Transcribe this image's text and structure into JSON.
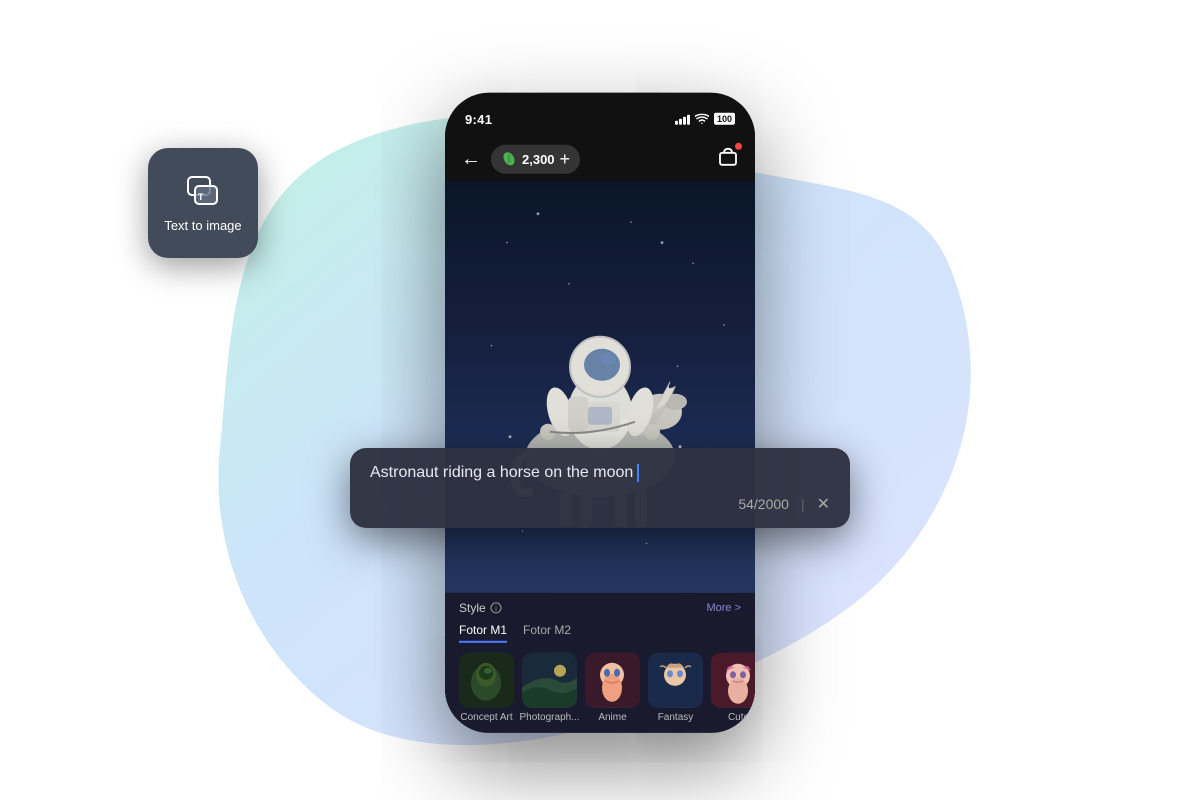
{
  "scene": {
    "background_blob_colors": {
      "top": "#b8f0e0",
      "bottom_left": "#b8d8f8",
      "bottom_right": "#c8d8ff"
    }
  },
  "status_bar": {
    "time": "9:41",
    "battery_label": "100"
  },
  "app_header": {
    "back_label": "←",
    "coin_count": "2,300",
    "plus_label": "+",
    "cart_icon_label": "🛒"
  },
  "hero": {
    "alt": "Astronaut riding a horse on the moon - AI generated art"
  },
  "text_to_image_card": {
    "label": "Text to image"
  },
  "prompt_tooltip": {
    "text": "Astronaut riding a horse on the moon",
    "char_count": "54/2000",
    "close_label": "✕"
  },
  "style_panel": {
    "style_label": "Style",
    "more_label": "More >",
    "tabs": [
      {
        "label": "Fotor M1",
        "active": true
      },
      {
        "label": "Fotor M2",
        "active": false
      }
    ],
    "items": [
      {
        "name": "Concept Art",
        "thumb_type": "concept"
      },
      {
        "name": "Photograph...",
        "thumb_type": "photo"
      },
      {
        "name": "Anime",
        "thumb_type": "anime"
      },
      {
        "name": "Fantasy",
        "thumb_type": "fantasy"
      },
      {
        "name": "Cute",
        "thumb_type": "pink"
      }
    ]
  }
}
